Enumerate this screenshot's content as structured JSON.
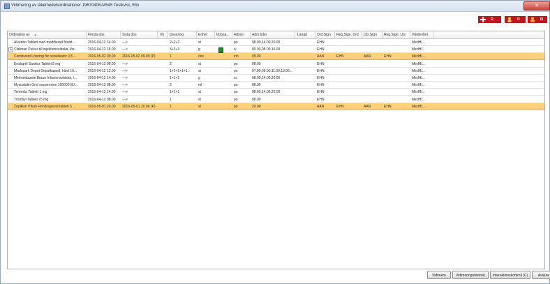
{
  "window": {
    "title": "Vidimering av läkemedelsordinationer 19670406-M545 Testkvist, Elin",
    "close_label": "✕"
  },
  "status_buttons": [
    {
      "label": "D",
      "icon": "allergy-icon",
      "color": "#c2161c"
    },
    {
      "label": "D",
      "icon": "warning-person-icon",
      "color": "#c2161c"
    },
    {
      "label": "III",
      "icon": "person-alert-icon",
      "color": "#c2161c"
    }
  ],
  "columns": [
    "Ordination av",
    "Första dos",
    "Sista dos",
    "Vb",
    "Dosering",
    "Enhet",
    "I/Dosa...",
    "Admin",
    "Adm.tider",
    "Längd",
    "Ord.Sign",
    "Reg.Sign. Ord",
    "Uts.Sign",
    "Reg.Sign. Uts",
    "Vårdenhet"
  ],
  "rows": [
    {
      "name": "Alvedon Tablett med modifierad frisätt...",
      "first": "2016-04-12 14.00",
      "last": "--->",
      "vb": "",
      "dosering": "2+2+2",
      "enhet": "st",
      "idosa": "",
      "admin": "po",
      "tider": "08.00,14.00,20.00",
      "langd": "",
      "ordsign": "EHN",
      "regord": "",
      "utssign": "",
      "reguts": "",
      "vard": "MedH/...",
      "highlight": false,
      "expander": false
    },
    {
      "name": "Claforan Pulver till injektionsvätska, lös...",
      "first": "2016-04-12 16.00",
      "last": "--->",
      "vb": "",
      "dosering": "3+3+3",
      "enhet": "g",
      "idosa": "green",
      "admin": "iv",
      "tider": "00.00,08.00,16.00",
      "langd": "",
      "ordsign": "EHN",
      "regord": "",
      "utssign": "",
      "reguts": "",
      "vard": "MedH/...",
      "highlight": false,
      "expander": true
    },
    {
      "name": "Combivent Lösning för nebulisator 0,5 ...",
      "first": "2016-05-02 09.00",
      "last": "2016-05-02 09.00 (P)",
      "vb": "",
      "dosering": "1",
      "enhet": "dos",
      "idosa": "",
      "admin": "inh",
      "tider": "09.00",
      "langd": "",
      "ordsign": "AAN",
      "regord": "EHN",
      "utssign": "AAN",
      "reguts": "EHN",
      "vard": "MedH/...",
      "highlight": true,
      "expander": false
    },
    {
      "name": "Enalapril Sandoz Tablett 5 mg",
      "first": "2016-04-13 08.00",
      "last": "--->",
      "vb": "",
      "dosering": "2",
      "enhet": "st",
      "idosa": "",
      "admin": "po",
      "tider": "08.00",
      "langd": "",
      "ordsign": "EHN",
      "regord": "",
      "utssign": "",
      "reguts": "",
      "vard": "MedH/...",
      "highlight": false,
      "expander": false
    },
    {
      "name": "Madopark Depot Depotkapsel, hård 10...",
      "first": "2016-04-12 13.00",
      "last": "--->",
      "vb": "",
      "dosering": "1+1+1+1+1...",
      "enhet": "st",
      "idosa": "",
      "admin": "po",
      "tider": "07.00,09.00,11.00,13.00...",
      "langd": "",
      "ordsign": "EHN",
      "regord": "",
      "utssign": "",
      "reguts": "",
      "vard": "MedH/...",
      "highlight": false,
      "expander": false
    },
    {
      "name": "Metronidazole Braun Infusionsvätska, l...",
      "first": "2016-04-12 14.00",
      "last": "--->",
      "vb": "",
      "dosering": "1+1+1",
      "enhet": "g",
      "idosa": "",
      "admin": "sc",
      "tider": "08.00,14.00,20.00",
      "langd": "",
      "ordsign": "EHN",
      "regord": "",
      "utssign": "",
      "reguts": "",
      "vard": "MedH/...",
      "highlight": false,
      "expander": false
    },
    {
      "name": "Mycostatin Oral suspension 100000 IE/...",
      "first": "2016-04-13 08.00",
      "last": "--->",
      "vb": "",
      "dosering": "2",
      "enhet": "ml",
      "idosa": "",
      "admin": "po",
      "tider": "08.00",
      "langd": "",
      "ordsign": "EHN",
      "regord": "",
      "utssign": "",
      "reguts": "",
      "vard": "MedH/...",
      "highlight": false,
      "expander": false
    },
    {
      "name": "Temesta Tablett 1 mg",
      "first": "2016-04-12 14.00",
      "last": "--->",
      "vb": "",
      "dosering": "1+1+1",
      "enhet": "st",
      "idosa": "",
      "admin": "po",
      "tider": "08.00,14.00,20.00",
      "langd": "",
      "ordsign": "EHN",
      "regord": "",
      "utssign": "",
      "reguts": "",
      "vard": "MedH/...",
      "highlight": false,
      "expander": false
    },
    {
      "name": "Trombyl Tablett 75 mg",
      "first": "2016-04-13 08.00",
      "last": "--->",
      "vb": "",
      "dosering": "1",
      "enhet": "st",
      "idosa": "",
      "admin": "po",
      "tider": "08.00",
      "langd": "",
      "ordsign": "EHN",
      "regord": "",
      "utssign": "",
      "reguts": "",
      "vard": "MedH/...",
      "highlight": false,
      "expander": false
    },
    {
      "name": "Zopiklon Pilum Filmdragerad tablett 5 ...",
      "first": "2016-05-01 20.00",
      "last": "2016-05-01 20.00 (P)",
      "vb": "",
      "dosering": "1",
      "enhet": "st",
      "idosa": "",
      "admin": "po",
      "tider": "20.00",
      "langd": "",
      "ordsign": "AAN",
      "regord": "EHN",
      "utssign": "AAN",
      "reguts": "EHN",
      "vard": "MedH/...",
      "highlight": true,
      "expander": false
    }
  ],
  "footer_buttons": {
    "vidimera": "Vidimera",
    "historik": "Vidimeringshistorik",
    "interaktion": "Interaktionskontroll (C)",
    "avsluta": "Avsluta"
  }
}
